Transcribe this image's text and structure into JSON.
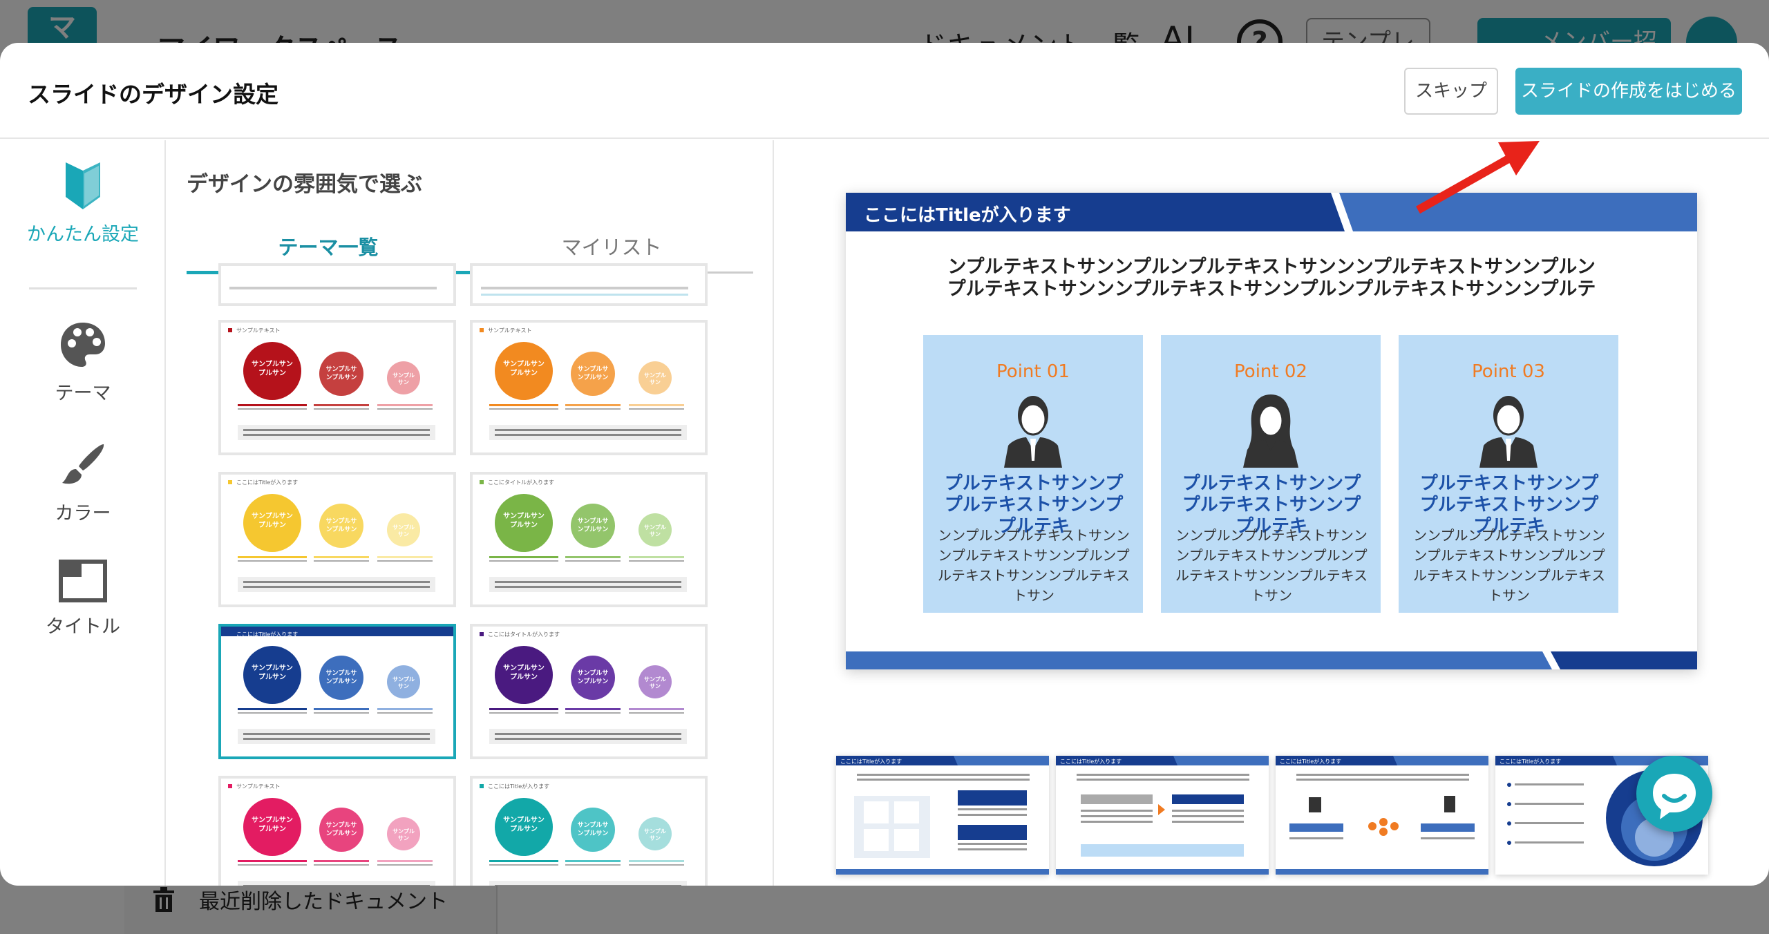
{
  "background": {
    "workspace_title": "マイワークスペース",
    "doclist_label": "ドキュメント一覧 ⌄",
    "ai_label": "AI",
    "help_label": "?",
    "template_label": "テンプレート",
    "invite_label": "メンバー招待",
    "trash_label": "最近削除したドキュメント"
  },
  "modal": {
    "title": "スライドのデザイン設定",
    "skip_label": "スキップ",
    "start_label": "スライドの作成をはじめる"
  },
  "nav": {
    "items": [
      {
        "label": "かんたん設定",
        "icon": "beginner-mark-icon",
        "active": true
      },
      {
        "label": "テーマ",
        "icon": "palette-icon",
        "active": false
      },
      {
        "label": "カラー",
        "icon": "brush-icon",
        "active": false
      },
      {
        "label": "タイトル",
        "icon": "title-layout-icon",
        "active": false
      }
    ]
  },
  "panel": {
    "title": "デザインの雰囲気で選ぶ",
    "tabs": [
      {
        "label": "テーマ一覧",
        "active": true
      },
      {
        "label": "マイリスト",
        "active": false
      }
    ],
    "thumbs": [
      {
        "label": "サンプルテキスト",
        "colors": [
          "#b5121b",
          "#c5403f",
          "#eea0a6"
        ],
        "c1": "サンプルサンプルサン",
        "c2": "サンプルサンプルサン",
        "c3": "サンプルサン"
      },
      {
        "label": "サンプルテキスト",
        "colors": [
          "#f28a20",
          "#f5a24a",
          "#f9cf94"
        ],
        "c1": "サンプルサンプルサン",
        "c2": "サンプルサンプルサン",
        "c3": "サンプルサン"
      },
      {
        "label": "ここにはTitleが入ります",
        "colors": [
          "#f5c730",
          "#f8d860",
          "#faeaa4"
        ],
        "c1": "サンプルサンプルサン",
        "c2": "サンプルサンプルサン",
        "c3": "サンプルサン"
      },
      {
        "label": "ここにタイトルが入ります",
        "colors": [
          "#7ab547",
          "#93c56b",
          "#bfe0a2"
        ],
        "c1": "サンプルサンプルサン",
        "c2": "サンプルサンプルサン",
        "c3": "サンプルサン"
      },
      {
        "label": "ここにはTitleが入ります",
        "colors": [
          "#163d8f",
          "#3d6ebd",
          "#8fb0e0"
        ],
        "c1": "サンプルサンプルサン",
        "c2": "サンプルサンプルサン",
        "c3": "サンプルサン",
        "selected": true
      },
      {
        "label": "ここにはタイトルが入ります",
        "colors": [
          "#4a1a80",
          "#6a3aa6",
          "#b289d0"
        ],
        "c1": "サンプルサンプルサン",
        "c2": "サンプルサンプルサン",
        "c3": "サンプルサン"
      },
      {
        "label": "サンプルテキスト",
        "colors": [
          "#e31c62",
          "#e8447e",
          "#f2a2bf"
        ],
        "c1": "サンプルサンプルサン",
        "c2": "サンプルサンプルサン",
        "c3": "サンプルサン"
      },
      {
        "label": "ここにはTitleが入ります",
        "colors": [
          "#12a8a8",
          "#4ec4c6",
          "#a5dedd"
        ],
        "c1": "サンプルサンプルサン",
        "c2": "サンプルサンプルサン",
        "c3": "サンプルサン"
      }
    ]
  },
  "preview": {
    "title": "ここにはTitleが入ります",
    "headline_1": "ンプルテキストサンンプルンプルテキストサンンンプルテキストサンンプルン",
    "headline_2": "プルテキストサンンンプルテキストサンンプルンプルテキストサンンンプルテ",
    "cards": [
      {
        "point": "Point 01",
        "head": "プルテキストサンンププルテキストサンンププルテキ",
        "body": "ンンプルンプルテキストサンンンプルテキストサンンプルンプルテキストサンンンプルテキストサン"
      },
      {
        "point": "Point 02",
        "head": "プルテキストサンンププルテキストサンンププルテキ",
        "body": "ンンプルンプルテキストサンンンプルテキストサンンプルンプルテキストサンンンプルテキストサン"
      },
      {
        "point": "Point 03",
        "head": "プルテキストサンンププルテキストサンンププルテキ",
        "body": "ンンプルンプルテキストサンンンプルテキストサンンプルンプルテキストサンンンプルテキストサン"
      }
    ],
    "mini_title": "ここにはTitleが入ります"
  },
  "colors": {
    "accent": "#1aa7b7",
    "start_button": "#3aafc5",
    "slide_blue": "#1c51a8",
    "card_bg": "#bcdcf6",
    "point_orange": "#f07b22",
    "arrow_red": "#e8231a"
  }
}
